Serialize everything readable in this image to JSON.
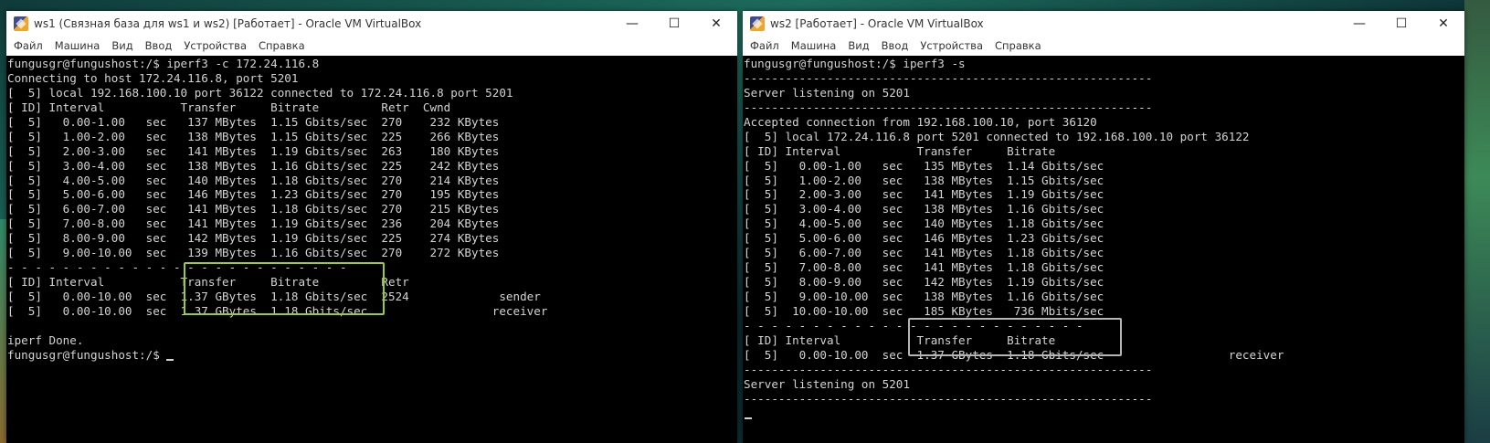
{
  "colors": {
    "highlight_green": "#9acd32",
    "highlight_grey": "#b5b5b5",
    "terminal_bg": "#000000",
    "terminal_fg": "#d4d4d4"
  },
  "menu": [
    "Файл",
    "Машина",
    "Вид",
    "Ввод",
    "Устройства",
    "Справка"
  ],
  "controls": {
    "minimize": "—",
    "maximize": "☐",
    "close": "✕"
  },
  "win1": {
    "title": "ws1 (Связная база для ws1 и ws2) [Работает] - Oracle VM VirtualBox",
    "lines": [
      "fungusgr@fungushost:/$ iperf3 -c 172.24.116.8",
      "Connecting to host 172.24.116.8, port 5201",
      "[  5] local 192.168.100.10 port 36122 connected to 172.24.116.8 port 5201",
      "[ ID] Interval           Transfer     Bitrate         Retr  Cwnd",
      "[  5]   0.00-1.00   sec   137 MBytes  1.15 Gbits/sec  270    232 KBytes",
      "[  5]   1.00-2.00   sec   138 MBytes  1.15 Gbits/sec  225    266 KBytes",
      "[  5]   2.00-3.00   sec   141 MBytes  1.19 Gbits/sec  263    180 KBytes",
      "[  5]   3.00-4.00   sec   138 MBytes  1.16 Gbits/sec  225    242 KBytes",
      "[  5]   4.00-5.00   sec   140 MBytes  1.18 Gbits/sec  270    214 KBytes",
      "[  5]   5.00-6.00   sec   146 MBytes  1.23 Gbits/sec  270    195 KBytes",
      "[  5]   6.00-7.00   sec   141 MBytes  1.18 Gbits/sec  270    215 KBytes",
      "[  5]   7.00-8.00   sec   141 MBytes  1.19 Gbits/sec  236    204 KBytes",
      "[  5]   8.00-9.00   sec   142 MBytes  1.19 Gbits/sec  225    274 KBytes",
      "[  5]   9.00-10.00  sec   139 MBytes  1.16 Gbits/sec  270    272 KBytes",
      "- - - - - - - - - - - - - - - - - - - - - - - - -",
      "[ ID] Interval           Transfer     Bitrate         Retr",
      "[  5]   0.00-10.00  sec  1.37 GBytes  1.18 Gbits/sec  2524             sender",
      "[  5]   0.00-10.00  sec  1.37 GBytes  1.18 Gbits/sec                  receiver",
      "",
      "iperf Done.",
      "fungusgr@fungushost:/$ "
    ]
  },
  "win2": {
    "title": "ws2 [Работает] - Oracle VM VirtualBox",
    "lines": [
      "fungusgr@fungushost:/$ iperf3 -s",
      "-----------------------------------------------------------",
      "Server listening on 5201",
      "-----------------------------------------------------------",
      "Accepted connection from 192.168.100.10, port 36120",
      "[  5] local 172.24.116.8 port 5201 connected to 192.168.100.10 port 36122",
      "[ ID] Interval           Transfer     Bitrate",
      "[  5]   0.00-1.00   sec   135 MBytes  1.14 Gbits/sec",
      "[  5]   1.00-2.00   sec   138 MBytes  1.15 Gbits/sec",
      "[  5]   2.00-3.00   sec   141 MBytes  1.19 Gbits/sec",
      "[  5]   3.00-4.00   sec   138 MBytes  1.16 Gbits/sec",
      "[  5]   4.00-5.00   sec   140 MBytes  1.18 Gbits/sec",
      "[  5]   5.00-6.00   sec   146 MBytes  1.23 Gbits/sec",
      "[  5]   6.00-7.00   sec   141 MBytes  1.18 Gbits/sec",
      "[  5]   7.00-8.00   sec   141 MBytes  1.18 Gbits/sec",
      "[  5]   8.00-9.00   sec   142 MBytes  1.19 Gbits/sec",
      "[  5]   9.00-10.00  sec   138 MBytes  1.16 Gbits/sec",
      "[  5]  10.00-10.00  sec   185 KBytes   736 Mbits/sec",
      "- - - - - - - - - - - - - - - - - - - - - - - - -",
      "[ ID] Interval           Transfer     Bitrate",
      "[  5]   0.00-10.00  sec  1.37 GBytes  1.18 Gbits/sec                  receiver",
      "-----------------------------------------------------------",
      "Server listening on 5201",
      "-----------------------------------------------------------",
      ""
    ]
  }
}
